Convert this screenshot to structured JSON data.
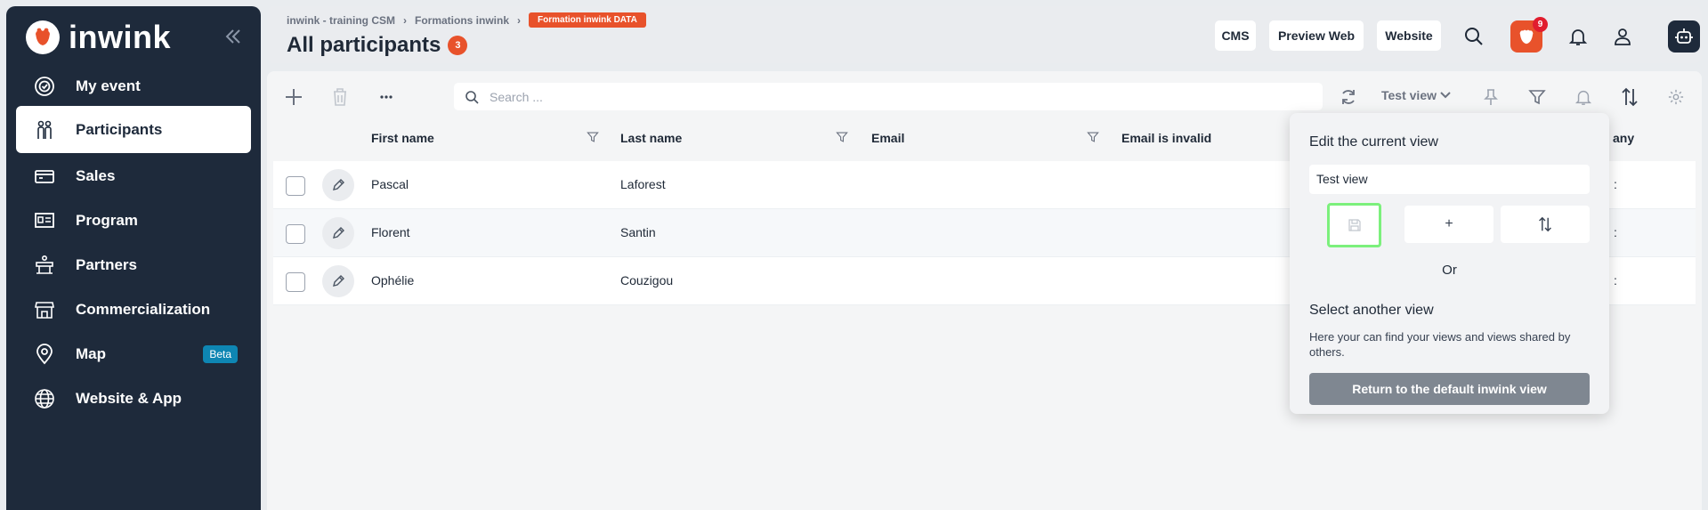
{
  "sidebar": {
    "brand": "inwink",
    "items": [
      {
        "label": "My event",
        "icon": "target-icon"
      },
      {
        "label": "Participants",
        "icon": "people-icon",
        "active": true
      },
      {
        "label": "Sales",
        "icon": "ticket-icon"
      },
      {
        "label": "Program",
        "icon": "presentation-icon"
      },
      {
        "label": "Partners",
        "icon": "podium-icon"
      },
      {
        "label": "Commercialization",
        "icon": "storefront-icon"
      },
      {
        "label": "Map",
        "icon": "map-pin-icon",
        "badge": "Beta"
      },
      {
        "label": "Website & App",
        "icon": "globe-icon"
      }
    ]
  },
  "header": {
    "breadcrumb": [
      "inwink - training CSM",
      "Formations inwink"
    ],
    "breadcrumb_badge": "Formation inwink DATA",
    "title": "All participants",
    "count": "3",
    "buttons": {
      "cms": "CMS",
      "preview": "Preview Web",
      "website": "Website"
    },
    "notification_count": "9"
  },
  "toolbar": {
    "search_placeholder": "Search ...",
    "view_name": "Test view"
  },
  "table": {
    "columns": [
      "First name",
      "Last name",
      "Email",
      "Email is invalid",
      "any"
    ],
    "rows": [
      {
        "first": "Pascal",
        "last": "Laforest",
        "trail": ":"
      },
      {
        "first": "Florent",
        "last": "Santin",
        "trail": ":"
      },
      {
        "first": "Ophélie",
        "last": "Couzigou",
        "trail": ":"
      }
    ]
  },
  "popover": {
    "title": "Edit the current view",
    "view_name": "Test view",
    "add_label": "+",
    "or_label": "Or",
    "select_title": "Select another view",
    "description": "Here your can find your views and views shared by others.",
    "return_label": "Return to the default inwink view"
  },
  "colors": {
    "sidebar_bg": "#1e2a3b",
    "accent": "#e8522b",
    "beta": "#0e86b3",
    "highlight": "#7cf07c"
  }
}
